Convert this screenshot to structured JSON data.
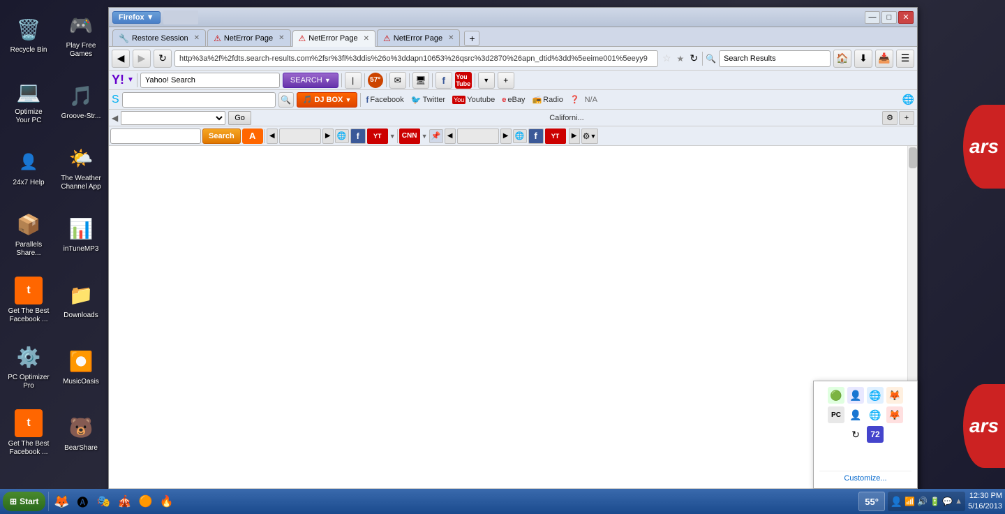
{
  "desktop": {
    "background": "#2d2d3d"
  },
  "desktop_icons": [
    {
      "id": "recycle-bin",
      "label": "Recycle Bin",
      "icon": "🗑️",
      "col": 0
    },
    {
      "id": "optimize-pc",
      "label": "Optimize Your PC",
      "icon": "💻",
      "col": 0
    },
    {
      "id": "247help",
      "label": "24x7 Help",
      "icon": "👤",
      "col": 0
    },
    {
      "id": "parallels",
      "label": "Parallels Share...",
      "icon": "📦",
      "col": 0
    },
    {
      "id": "facebook1",
      "label": "Get The Best Facebook ...",
      "icon": "🅣",
      "col": 0
    },
    {
      "id": "pc-optimizer-pro",
      "label": "PC Optimizer Pro",
      "icon": "⚙️",
      "col": 1
    },
    {
      "id": "facebook2",
      "label": "Get The Best Facebook ...",
      "icon": "🅣",
      "col": 1
    },
    {
      "id": "play-games",
      "label": "Play Free Games",
      "icon": "🎮",
      "col": 1
    },
    {
      "id": "groove",
      "label": "Groove-Str...",
      "icon": "🎵",
      "col": 1
    },
    {
      "id": "weather",
      "label": "The Weather Channel App",
      "icon": "🌤️",
      "col": 1
    },
    {
      "id": "itune-mp3",
      "label": "inTuneMP3",
      "icon": "📊",
      "col": 1
    },
    {
      "id": "downloads",
      "label": "Downloads",
      "icon": "📁",
      "col": 1
    },
    {
      "id": "music-oasis",
      "label": "MusicOasis",
      "icon": "⏺️",
      "col": 1
    },
    {
      "id": "bearshare",
      "label": "BearShare",
      "icon": "🐻",
      "col": 1
    }
  ],
  "browser": {
    "title": "Firefox",
    "tabs": [
      {
        "label": "Restore Session",
        "icon": "🔧",
        "active": false,
        "closeable": true
      },
      {
        "label": "NetError Page",
        "icon": "🔴",
        "active": false,
        "closeable": true
      },
      {
        "label": "NetError Page",
        "icon": "🔴",
        "active": true,
        "closeable": true
      },
      {
        "label": "NetError Page",
        "icon": "🔴",
        "active": false,
        "closeable": true
      }
    ],
    "url": "http%3a%2f%2fdts.search-results.com%2fsr%3fl%3ddis%26o%3ddapn10653%26qsrc%3d2870%26apn_dtid%3dd%5eeime001%5eeyy9",
    "search_placeholder": "Search Results",
    "yahoo_search_placeholder": "Yahoo! Search",
    "search_btn": "SEARCH",
    "temperature": "57°",
    "toolbar2": {
      "dj_box": "DJ BOX",
      "links": [
        "Facebook",
        "Twitter",
        "Youtube",
        "eBay",
        "Radio",
        "N/A"
      ]
    },
    "toolbar3": {
      "california": "Californi...",
      "go": "Go"
    },
    "toolbar4": {
      "search_btn": "Search",
      "bookmarks": [
        "YouTube",
        "CNN",
        "YouTube"
      ]
    }
  },
  "system_tray_popup": {
    "icons": [
      "🟢",
      "👤",
      "🌐",
      "🦊",
      "💻",
      "🌐",
      "🟠",
      "⚡",
      "72"
    ],
    "customize": "Customize..."
  },
  "taskbar": {
    "start_label": "Start",
    "temperature": "55°",
    "time": "12:30 PM",
    "date": "5/16/2013",
    "apps": [
      "🦊",
      "🅐",
      "🎭",
      "🎪",
      "🌀",
      "🔥"
    ]
  }
}
